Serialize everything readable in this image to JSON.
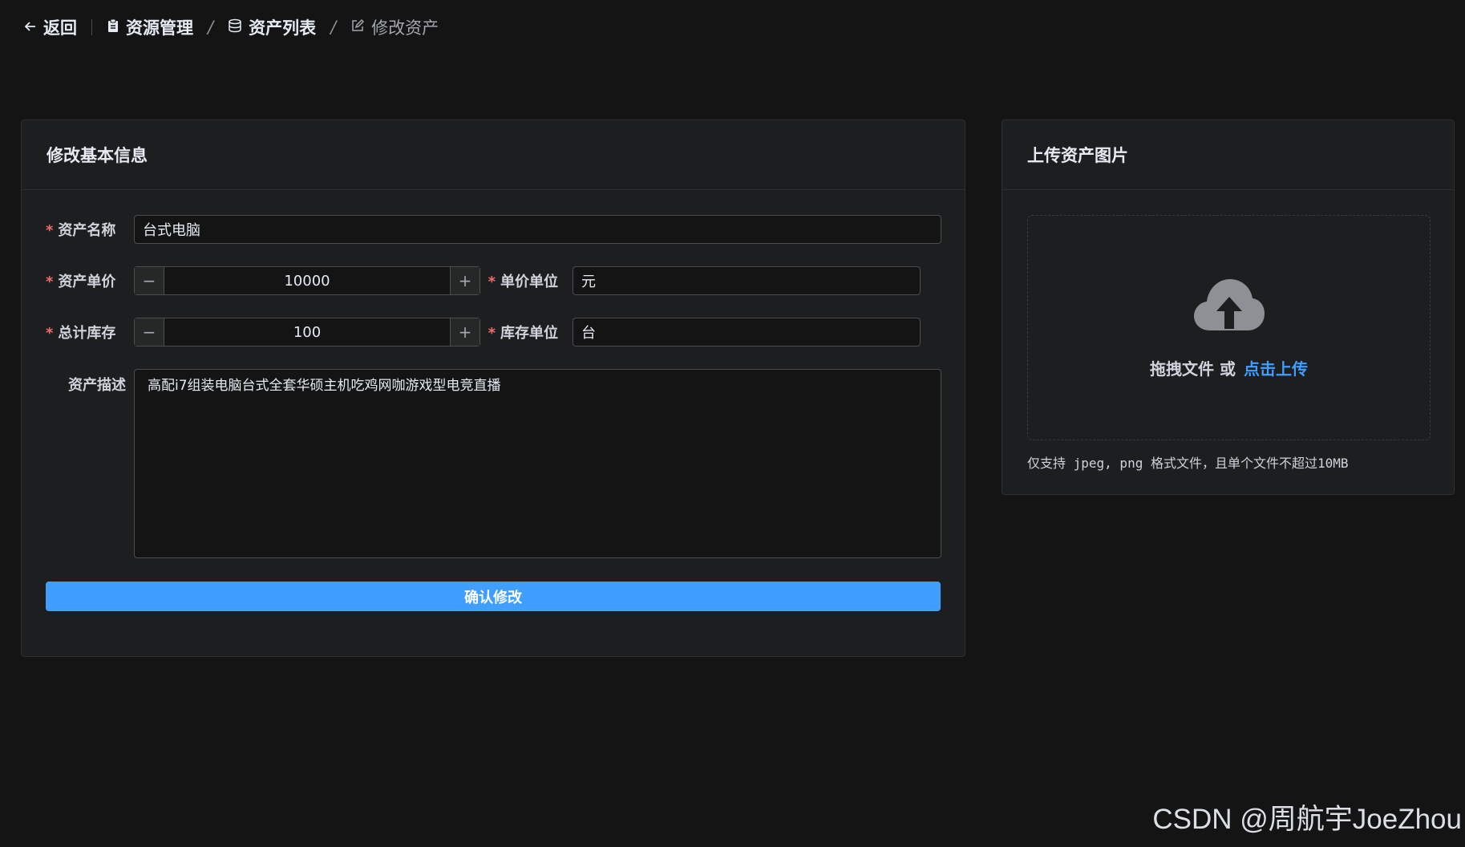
{
  "nav": {
    "back_label": "返回",
    "breadcrumbs": [
      "资源管理",
      "资产列表",
      "修改资产"
    ],
    "separator": "/"
  },
  "basic_card": {
    "title": "修改基本信息",
    "name": {
      "label": "资产名称",
      "value": "台式电脑"
    },
    "price": {
      "label": "资产单价",
      "value": "10000",
      "minus": "−",
      "plus": "+"
    },
    "price_unit": {
      "label": "单价单位",
      "value": "元"
    },
    "stock": {
      "label": "总计库存",
      "value": "100",
      "minus": "−",
      "plus": "+"
    },
    "stock_unit": {
      "label": "库存单位",
      "value": "台"
    },
    "description": {
      "label": "资产描述",
      "value": "高配i7组装电脑台式全套华硕主机吃鸡网咖游戏型电竞直播"
    },
    "required_mark": "*",
    "submit_label": "确认修改"
  },
  "upload_card": {
    "title": "上传资产图片",
    "drag_text": "拖拽文件 或",
    "click_text": "点击上传",
    "tip": "仅支持 jpeg, png 格式文件，且单个文件不超过10MB"
  },
  "watermark": "CSDN @周航宇JoeZhou",
  "colors": {
    "accent": "#409eff",
    "required": "#f56c6c",
    "background": "#141414",
    "card": "#1d1e1f"
  }
}
